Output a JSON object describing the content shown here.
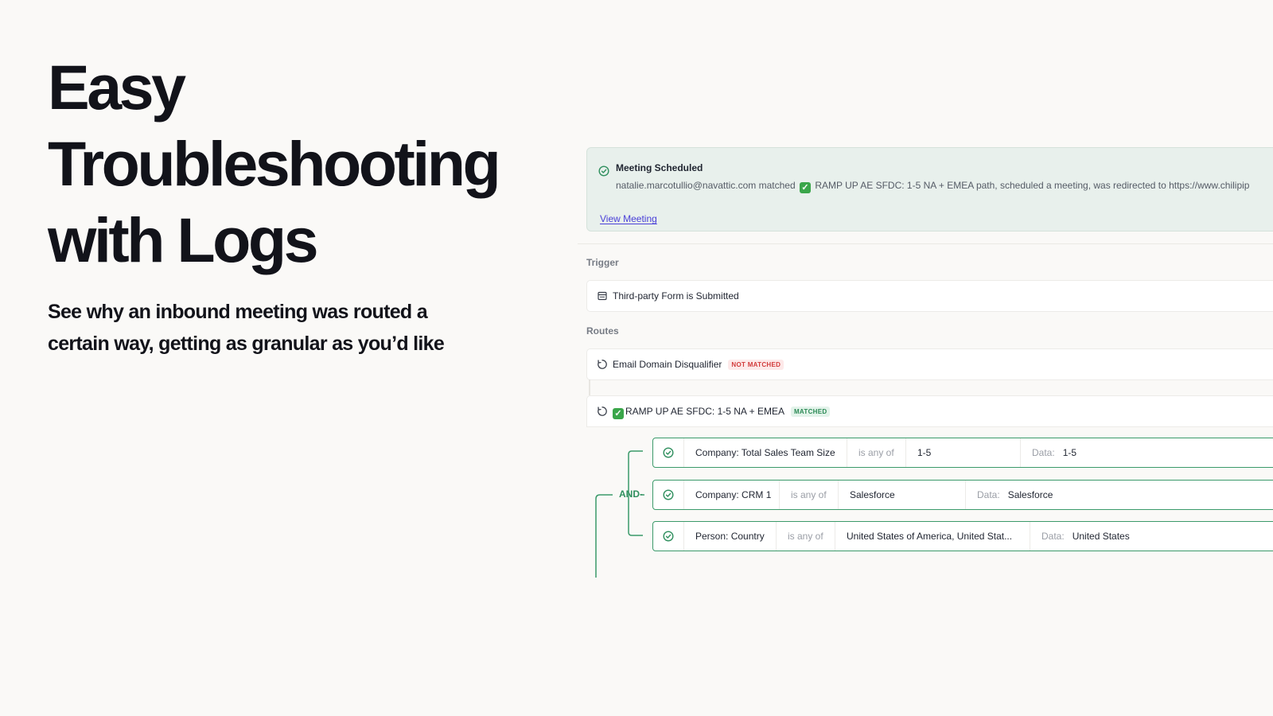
{
  "hero": {
    "title_lines": [
      "Easy",
      "Troubleshooting",
      "with Logs"
    ],
    "subtitle": "See why an inbound meeting was routed a certain way, getting as granular as you’d like"
  },
  "meeting": {
    "title": "Meeting Scheduled",
    "desc_pre": "natalie.marcotullio@navattic.com matched",
    "desc_post": "RAMP UP AE SFDC: 1-5 NA + EMEA path, scheduled a meeting, was redirected to https://www.chilipip",
    "view_link": "View Meeting"
  },
  "trigger": {
    "label": "Trigger",
    "text": "Third-party Form is Submitted"
  },
  "routes": {
    "label": "Routes",
    "items": [
      {
        "name": "Email Domain Disqualifier",
        "status": "NOT MATCHED"
      },
      {
        "name": "RAMP UP AE SFDC: 1-5 NA + EMEA",
        "status": "MATCHED"
      }
    ]
  },
  "logic": {
    "operator": "AND",
    "conditions": [
      {
        "field": "Company: Total Sales Team Size",
        "op": "is any of",
        "value": "1-5",
        "data_label": "Data:",
        "data": "1-5"
      },
      {
        "field": "Company: CRM 1",
        "op": "is any of",
        "value": "Salesforce",
        "data_label": "Data:",
        "data": "Salesforce"
      },
      {
        "field": "Person: Country",
        "op": "is any of",
        "value": "United States of America, United Stat...",
        "data_label": "Data:",
        "data": "United States"
      }
    ]
  },
  "colors": {
    "accent_green": "#3b9a6a",
    "link_purple": "#4a40d8",
    "not_matched_red": "#d23b3b"
  },
  "icons": {
    "check": "check-circle-icon",
    "form": "form-icon",
    "route": "route-icon"
  }
}
